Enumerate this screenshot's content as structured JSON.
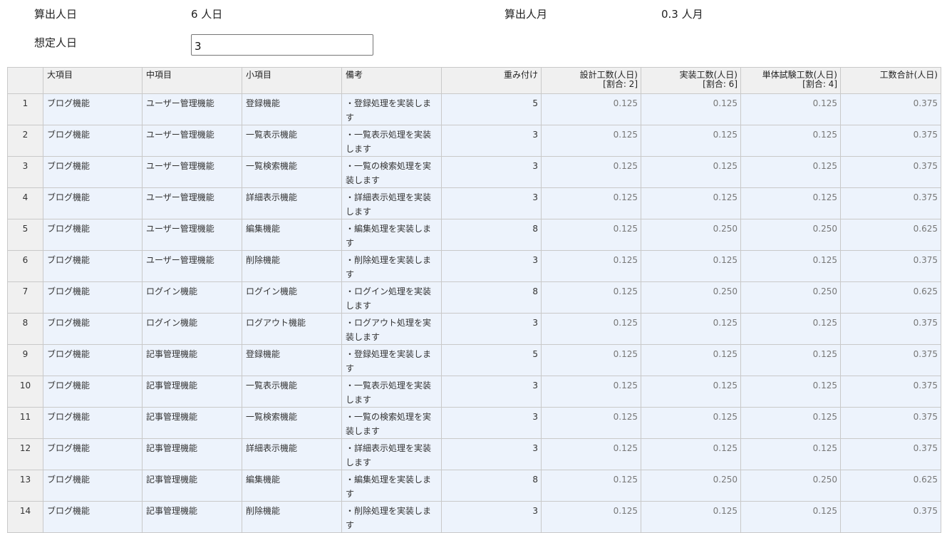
{
  "summary": {
    "calc_days_label": "算出人日",
    "calc_days_value": "6 人日",
    "calc_months_label": "算出人月",
    "calc_months_value": "0.3 人月",
    "assumed_days_label": "想定人日",
    "assumed_days_value": "3"
  },
  "table": {
    "headers": {
      "no": "",
      "major": "大項目",
      "middle": "中項目",
      "minor": "小項目",
      "note": "備考",
      "weight": "重み付け",
      "design": "設計工数(人日)",
      "design_ratio": "[割合: 2]",
      "impl": "実装工数(人日)",
      "impl_ratio": "[割合: 6]",
      "unit": "単体試験工数(人日)",
      "unit_ratio": "[割合: 4]",
      "total": "工数合計(人日)"
    },
    "rows": [
      {
        "no": "1",
        "major": "ブログ機能",
        "middle": "ユーザー管理機能",
        "minor": "登録機能",
        "note": "・登録処理を実装します",
        "weight": "5",
        "design": "0.125",
        "impl": "0.125",
        "unit": "0.125",
        "total": "0.375"
      },
      {
        "no": "2",
        "major": "ブログ機能",
        "middle": "ユーザー管理機能",
        "minor": "一覧表示機能",
        "note": "・一覧表示処理を実装します",
        "weight": "3",
        "design": "0.125",
        "impl": "0.125",
        "unit": "0.125",
        "total": "0.375"
      },
      {
        "no": "3",
        "major": "ブログ機能",
        "middle": "ユーザー管理機能",
        "minor": "一覧検索機能",
        "note": "・一覧の検索処理を実装します",
        "weight": "3",
        "design": "0.125",
        "impl": "0.125",
        "unit": "0.125",
        "total": "0.375"
      },
      {
        "no": "4",
        "major": "ブログ機能",
        "middle": "ユーザー管理機能",
        "minor": "詳細表示機能",
        "note": "・詳細表示処理を実装します",
        "weight": "3",
        "design": "0.125",
        "impl": "0.125",
        "unit": "0.125",
        "total": "0.375"
      },
      {
        "no": "5",
        "major": "ブログ機能",
        "middle": "ユーザー管理機能",
        "minor": "編集機能",
        "note": "・編集処理を実装します",
        "weight": "8",
        "design": "0.125",
        "impl": "0.250",
        "unit": "0.250",
        "total": "0.625"
      },
      {
        "no": "6",
        "major": "ブログ機能",
        "middle": "ユーザー管理機能",
        "minor": "削除機能",
        "note": "・削除処理を実装します",
        "weight": "3",
        "design": "0.125",
        "impl": "0.125",
        "unit": "0.125",
        "total": "0.375"
      },
      {
        "no": "7",
        "major": "ブログ機能",
        "middle": "ログイン機能",
        "minor": "ログイン機能",
        "note": "・ログイン処理を実装します",
        "weight": "8",
        "design": "0.125",
        "impl": "0.250",
        "unit": "0.250",
        "total": "0.625"
      },
      {
        "no": "8",
        "major": "ブログ機能",
        "middle": "ログイン機能",
        "minor": "ログアウト機能",
        "note": "・ログアウト処理を実装します",
        "weight": "3",
        "design": "0.125",
        "impl": "0.125",
        "unit": "0.125",
        "total": "0.375"
      },
      {
        "no": "9",
        "major": "ブログ機能",
        "middle": "記事管理機能",
        "minor": "登録機能",
        "note": "・登録処理を実装します",
        "weight": "5",
        "design": "0.125",
        "impl": "0.125",
        "unit": "0.125",
        "total": "0.375"
      },
      {
        "no": "10",
        "major": "ブログ機能",
        "middle": "記事管理機能",
        "minor": "一覧表示機能",
        "note": "・一覧表示処理を実装します",
        "weight": "3",
        "design": "0.125",
        "impl": "0.125",
        "unit": "0.125",
        "total": "0.375"
      },
      {
        "no": "11",
        "major": "ブログ機能",
        "middle": "記事管理機能",
        "minor": "一覧検索機能",
        "note": "・一覧の検索処理を実装します",
        "weight": "3",
        "design": "0.125",
        "impl": "0.125",
        "unit": "0.125",
        "total": "0.375"
      },
      {
        "no": "12",
        "major": "ブログ機能",
        "middle": "記事管理機能",
        "minor": "詳細表示機能",
        "note": "・詳細表示処理を実装します",
        "weight": "3",
        "design": "0.125",
        "impl": "0.125",
        "unit": "0.125",
        "total": "0.375"
      },
      {
        "no": "13",
        "major": "ブログ機能",
        "middle": "記事管理機能",
        "minor": "編集機能",
        "note": "・編集処理を実装します",
        "weight": "8",
        "design": "0.125",
        "impl": "0.250",
        "unit": "0.250",
        "total": "0.625"
      },
      {
        "no": "14",
        "major": "ブログ機能",
        "middle": "記事管理機能",
        "minor": "削除機能",
        "note": "・削除処理を実装します",
        "weight": "3",
        "design": "0.125",
        "impl": "0.125",
        "unit": "0.125",
        "total": "0.375"
      }
    ]
  }
}
